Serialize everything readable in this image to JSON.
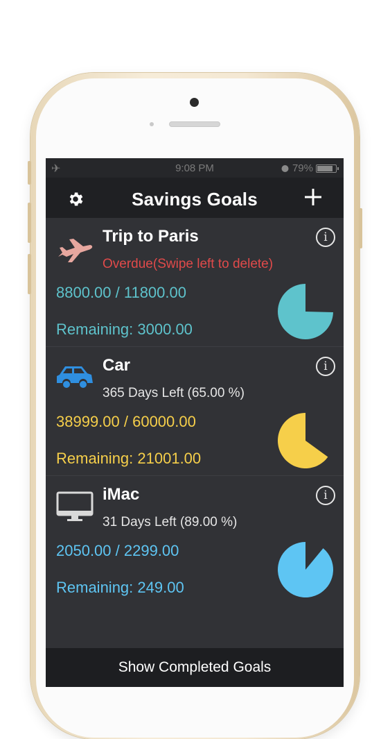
{
  "status_bar": {
    "time": "9:08 PM",
    "battery": "79%",
    "battery_level": 0.79
  },
  "nav": {
    "title": "Savings Goals",
    "left_icon": "gear-icon",
    "right_icon": "plus-icon"
  },
  "goals": [
    {
      "name": "Trip to Paris",
      "icon": "airplane-icon",
      "status": "Overdue(Swipe left to delete)",
      "amount": "8800.00 / 11800.00",
      "remaining": "Remaining: 3000.00",
      "color": "#5ec3cc",
      "status_color": "#e04a4a",
      "icon_color": "#e7a79f",
      "progress": 0.7458
    },
    {
      "name": "Car",
      "icon": "car-icon",
      "status": "365 Days Left (65.00 %)",
      "amount": "38999.00 / 60000.00",
      "remaining": "Remaining: 21001.00",
      "color": "#f6cf4a",
      "status_color": "#e6e6e6",
      "icon_color": "#2f8fe0",
      "progress": 0.65
    },
    {
      "name": "iMac",
      "icon": "monitor-icon",
      "status": "31 Days Left (89.00 %)",
      "amount": "2050.00 / 2299.00",
      "remaining": "Remaining: 249.00",
      "color": "#5ec5f3",
      "status_color": "#e6e6e6",
      "icon_color": "#d9d9d9",
      "progress": 0.89
    }
  ],
  "footer": {
    "label": "Show Completed Goals"
  }
}
